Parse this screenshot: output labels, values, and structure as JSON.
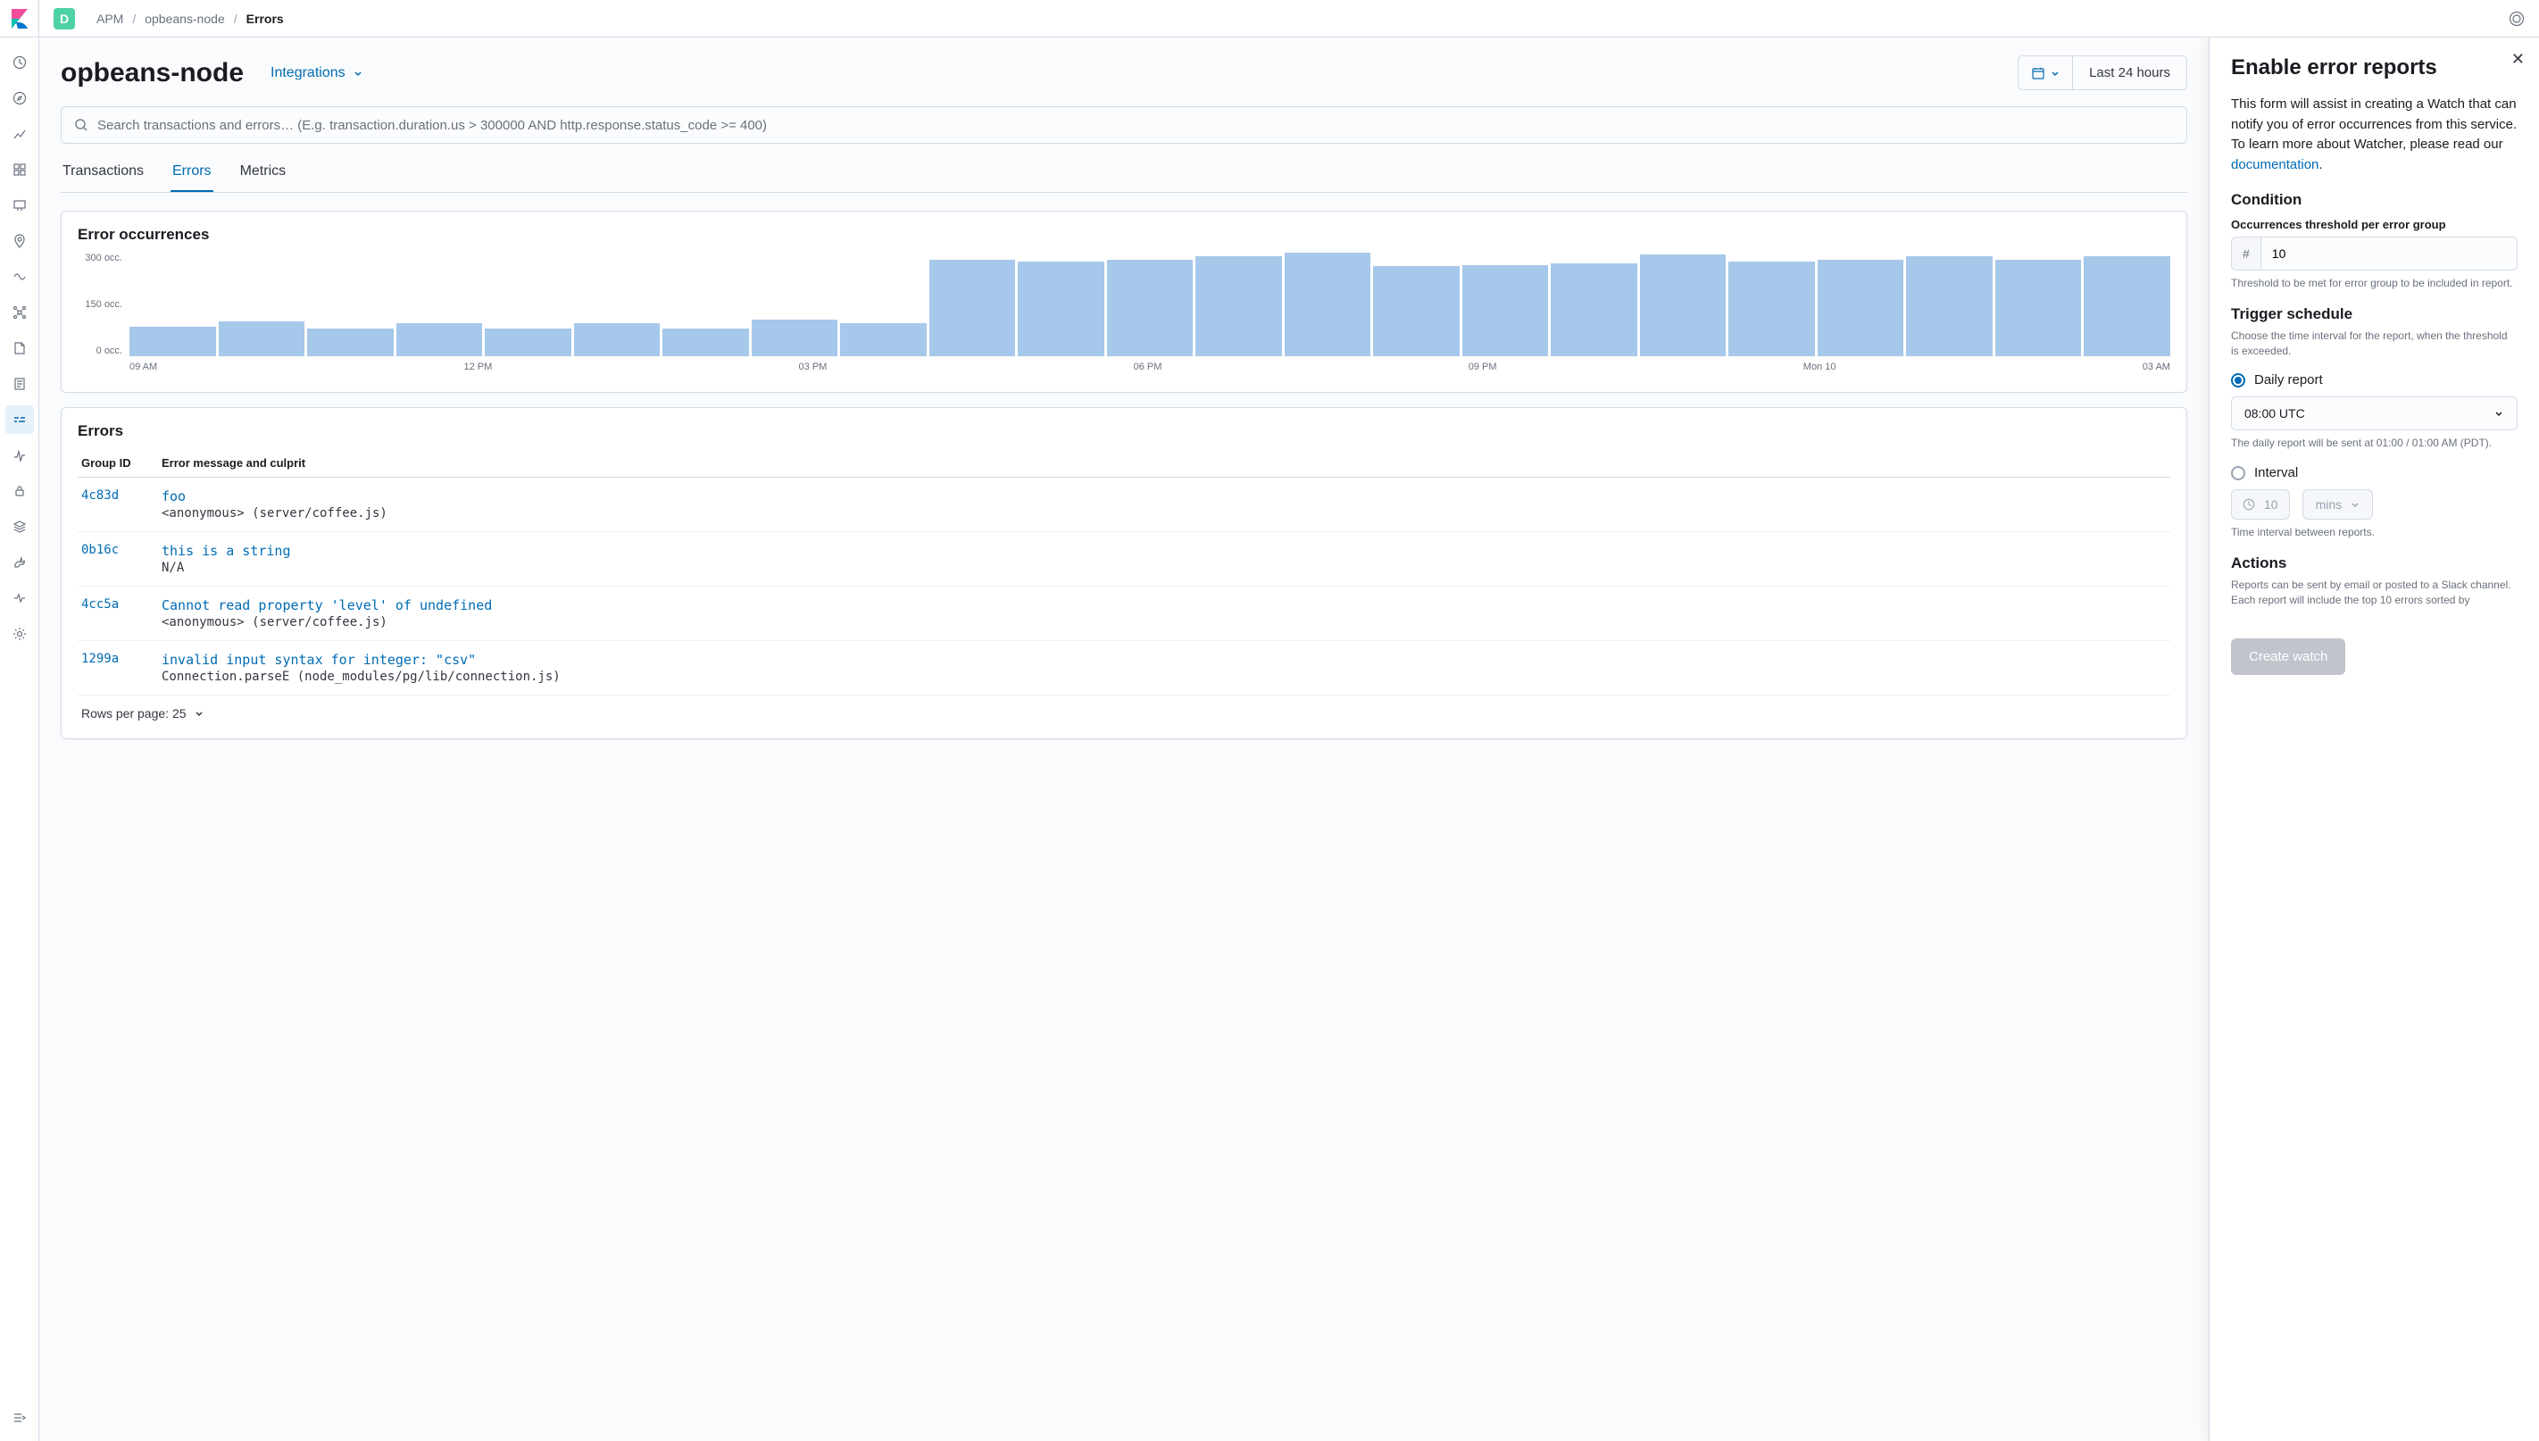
{
  "breadcrumbs": {
    "app": "APM",
    "service": "opbeans-node",
    "page": "Errors"
  },
  "space_initial": "D",
  "page_title": "opbeans-node",
  "integrations_label": "Integrations",
  "date_range_label": "Last 24 hours",
  "search_placeholder": "Search transactions and errors… (E.g. transaction.duration.us > 300000 AND http.response.status_code >= 400)",
  "tabs": [
    "Transactions",
    "Errors",
    "Metrics"
  ],
  "active_tab": "Errors",
  "occ_panel_title": "Error occurrences",
  "errors_panel_title": "Errors",
  "table_headers": {
    "group": "Group ID",
    "msg": "Error message and culprit"
  },
  "errors": [
    {
      "id": "4c83d",
      "msg": "foo",
      "culprit": "<anonymous> (server/coffee.js)"
    },
    {
      "id": "0b16c",
      "msg": "this is a string",
      "culprit": "N/A"
    },
    {
      "id": "4cc5a",
      "msg": "Cannot read property 'level' of undefined",
      "culprit": "<anonymous> (server/coffee.js)"
    },
    {
      "id": "1299a",
      "msg": "invalid input syntax for integer: \"csv\"",
      "culprit": "Connection.parseE (node_modules/pg/lib/connection.js)"
    }
  ],
  "rows_per_page": "Rows per page: 25",
  "chart_data": {
    "type": "bar",
    "ylabel": "occ.",
    "yticks": [
      "300 occ.",
      "150 occ.",
      "0 occ."
    ],
    "ylim": [
      0,
      300
    ],
    "xticks": [
      "09 AM",
      "12 PM",
      "03 PM",
      "06 PM",
      "09 PM",
      "Mon 10",
      "03 AM"
    ],
    "values": [
      85,
      100,
      80,
      95,
      80,
      95,
      80,
      105,
      95,
      280,
      275,
      280,
      290,
      300,
      260,
      265,
      270,
      295,
      275,
      280,
      290,
      280,
      290
    ]
  },
  "flyout": {
    "title": "Enable error reports",
    "intro_1": "This form will assist in creating a Watch that can notify you of error occurrences from this service. To learn more about Watcher, please read our ",
    "intro_link": "documentation",
    "intro_2": ".",
    "condition_title": "Condition",
    "threshold_label": "Occurrences threshold per error group",
    "threshold_prefix": "#",
    "threshold_value": "10",
    "threshold_help": "Threshold to be met for error group to be included in report.",
    "trigger_title": "Trigger schedule",
    "trigger_help": "Choose the time interval for the report, when the threshold is exceeded.",
    "daily_label": "Daily report",
    "daily_value": "08:00 UTC",
    "daily_help": "The daily report will be sent at 01:00 / 01:00 AM (PDT).",
    "interval_label": "Interval",
    "interval_value": "10",
    "interval_unit": "mins",
    "interval_help": "Time interval between reports.",
    "actions_title": "Actions",
    "actions_help": "Reports can be sent by email or posted to a Slack channel. Each report will include the top 10 errors sorted by",
    "create_label": "Create watch"
  }
}
